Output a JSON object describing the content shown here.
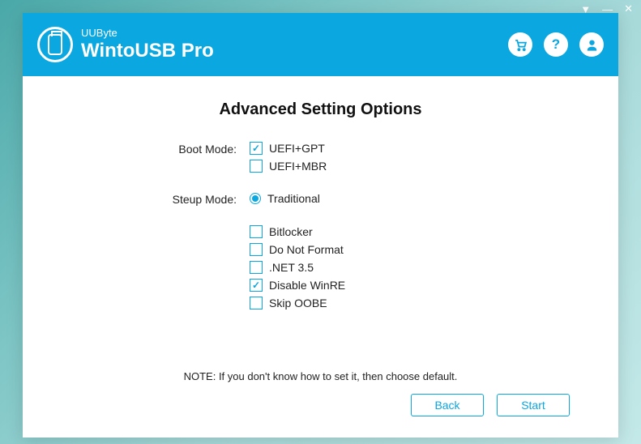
{
  "brand": {
    "small": "UUByte",
    "big": "WintoUSB Pro"
  },
  "heading": "Advanced Setting Options",
  "bootMode": {
    "label": "Boot Mode:",
    "options": [
      {
        "label": "UEFI+GPT",
        "checked": true
      },
      {
        "label": "UEFI+MBR",
        "checked": false
      }
    ]
  },
  "setupMode": {
    "label": "Steup Mode:",
    "radio": {
      "label": "Traditional",
      "checked": true
    },
    "options": [
      {
        "label": "Bitlocker",
        "checked": false
      },
      {
        "label": "Do Not Format",
        "checked": false
      },
      {
        "label": ".NET 3.5",
        "checked": false
      },
      {
        "label": "Disable WinRE",
        "checked": true
      },
      {
        "label": "Skip OOBE",
        "checked": false
      }
    ]
  },
  "note": "NOTE: If you don't know how to set it, then choose default.",
  "buttons": {
    "back": "Back",
    "start": "Start"
  }
}
